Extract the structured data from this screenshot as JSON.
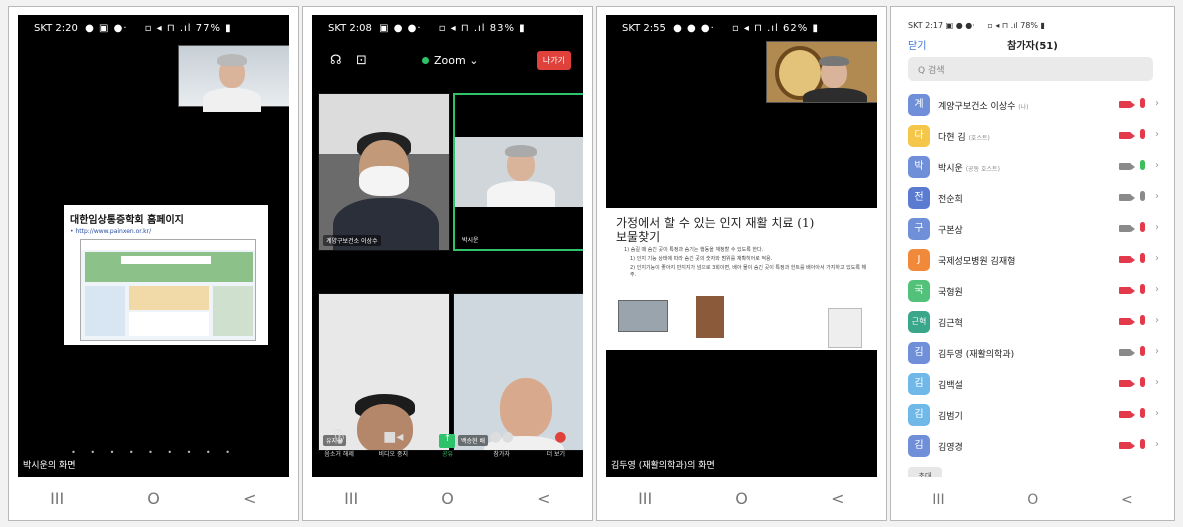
{
  "colors": {
    "zoom_green": "#2ec26b",
    "leave_red": "#e0413a",
    "link_blue": "#3873d8",
    "muted_red": "#e23a4a",
    "icon_gray": "#8a8a8a"
  },
  "nav_icons": [
    "recents-icon",
    "home-icon",
    "back-icon"
  ],
  "nav_glyphs": [
    "III",
    "O",
    "<"
  ],
  "panel1": {
    "status": {
      "time": "SKT 2:20",
      "battery": "77%"
    },
    "slide_title": "대한임상통증학회 홈페이지",
    "slide_url": "• http://www.painxen.or.kr/",
    "dots": "• • • • • • • • •",
    "caption": "박시운의 화면"
  },
  "panel2": {
    "status": {
      "time": "SKT 2:08",
      "battery": "83%"
    },
    "zoom_label": "Zoom ⌄",
    "leave_label": "나가기",
    "tiles": [
      {
        "name": "계양구보건소 이상수"
      },
      {
        "name": "박시운"
      },
      {
        "name": "유지원"
      },
      {
        "name": "백승현 배"
      }
    ],
    "toolbar": [
      {
        "label": "음소거 해제",
        "icon": "mic-off-icon"
      },
      {
        "label": "비디오 중지",
        "icon": "video-icon"
      },
      {
        "label": "공유",
        "icon": "share-icon"
      },
      {
        "label": "참가자",
        "icon": "participants-icon"
      },
      {
        "label": "더 보기",
        "icon": "more-icon"
      }
    ]
  },
  "panel3": {
    "status": {
      "time": "SKT 2:55",
      "battery": "62%"
    },
    "slide_title_1": "가정에서 할 수 있는 인지 재활 치료 (1)",
    "slide_title_2": "보물찾기",
    "bullets": [
      "1) 숨길 때 숨긴 곳이 특정과 숨기는 행동을 재청할 수 있도록 한다.",
      "1) 인지 기능 상태에 따라 숨긴 곳의 숫자와 범위를 재확히어로 적용.",
      "2) 인지기능이 좋아지 만지지가 넘으로 3회이면, 배아 물이 숨긴 곳이 특정과 힌트를 배아아서 가지하고 있도록 해 주."
    ],
    "caption": "김두영 (재활의학과)의 화면"
  },
  "panel4": {
    "status": {
      "time": "SKT 2:17",
      "battery": "78%"
    },
    "close_label": "닫기",
    "title": "참가자(51)",
    "search_placeholder": "Q 검색",
    "invite_label": "초대",
    "participants": [
      {
        "avatar": "계",
        "color": "#6f8fd8",
        "name": "계양구보건소 이상수",
        "tag": "(나)",
        "cam": "off",
        "mic": "muted"
      },
      {
        "avatar": "다",
        "color": "#f4c74a",
        "name": "다현 김",
        "tag": "(호스트)",
        "cam": "off",
        "mic": "muted"
      },
      {
        "avatar": "박",
        "color": "#6f8fd8",
        "name": "박시운",
        "tag": "(공동 호스트)",
        "cam": "on",
        "mic": "active"
      },
      {
        "avatar": "전",
        "color": "#5a7bd0",
        "name": "전순희",
        "tag": "",
        "cam": "on",
        "mic": "on"
      },
      {
        "avatar": "구",
        "color": "#6f8fd8",
        "name": "구본상",
        "tag": "",
        "cam": "on",
        "mic": "muted"
      },
      {
        "avatar": "J",
        "color": "#f08a3a",
        "name": "국제성모병원 김재형",
        "tag": "",
        "cam": "off",
        "mic": "muted"
      },
      {
        "avatar": "국",
        "color": "#52c27a",
        "name": "국형원",
        "tag": "",
        "cam": "off",
        "mic": "muted"
      },
      {
        "avatar": "근혁",
        "color": "#3aa68a",
        "name": "김근혁",
        "tag": "",
        "cam": "off",
        "mic": "muted"
      },
      {
        "avatar": "김",
        "color": "#6f8fd8",
        "name": "김두영 (재활의학과)",
        "tag": "",
        "cam": "on",
        "mic": "muted"
      },
      {
        "avatar": "김",
        "color": "#6fb8e8",
        "name": "김백설",
        "tag": "",
        "cam": "off",
        "mic": "muted"
      },
      {
        "avatar": "김",
        "color": "#6fb8e8",
        "name": "김범기",
        "tag": "",
        "cam": "off",
        "mic": "muted"
      },
      {
        "avatar": "김",
        "color": "#6f8fd8",
        "name": "김영경",
        "tag": "",
        "cam": "off",
        "mic": "muted"
      }
    ]
  }
}
